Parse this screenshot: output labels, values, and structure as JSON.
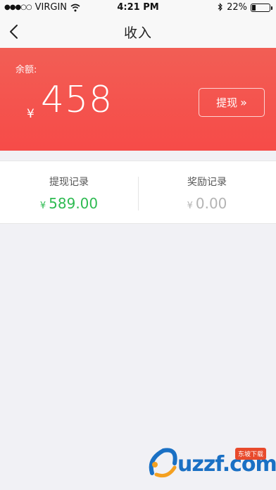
{
  "status_bar": {
    "signal": "●●●○○",
    "carrier": "VIRGIN",
    "time": "4:21 PM",
    "battery": "22%",
    "battery_level": 0.22
  },
  "nav": {
    "title": "收入"
  },
  "balance": {
    "label": "余额:",
    "currency": "¥",
    "amount": "458",
    "withdraw_label": "提现",
    "withdraw_icon": "»"
  },
  "stats": {
    "withdraw_records": {
      "label": "提现记录",
      "currency": "¥",
      "value": "589.00"
    },
    "reward_records": {
      "label": "奖励记录",
      "currency": "¥",
      "value": "0.00"
    }
  },
  "watermark": {
    "text": "uzzf.com",
    "badge": "东坡下载"
  },
  "colors": {
    "accent": "#f64b48",
    "positive": "#2fbb52",
    "muted": "#b4b4b4"
  }
}
